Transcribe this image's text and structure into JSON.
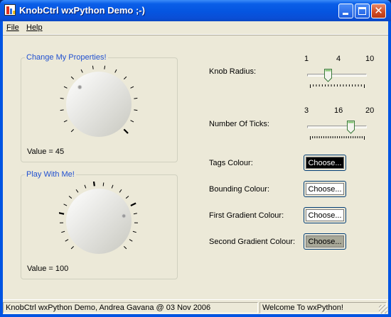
{
  "window": {
    "title": "KnobCtrl wxPython Demo ;-)"
  },
  "menubar": {
    "file": "File",
    "help": "Help"
  },
  "knob1": {
    "group_title": "Change My Properties!",
    "value_text": "Value = 45"
  },
  "knob2": {
    "group_title": "Play With Me!",
    "value_text": "Value = 100"
  },
  "controls": {
    "knob_radius": {
      "label": "Knob Radius:",
      "tick_labels": [
        "1",
        "4",
        "10"
      ],
      "value": 4,
      "min": 1,
      "max": 10
    },
    "number_of_ticks": {
      "label": "Number Of Ticks:",
      "tick_labels": [
        "3",
        "16",
        "20"
      ],
      "value": 16,
      "min": 3,
      "max": 20
    },
    "tags_colour": {
      "label": "Tags Colour:",
      "button": "Choose...",
      "swatch": "#000000",
      "text_color": "#ffffff"
    },
    "bounding_colour": {
      "label": "Bounding Colour:",
      "button": "Choose...",
      "swatch": "#ffffff",
      "text_color": "#000000"
    },
    "first_gradient_colour": {
      "label": "First Gradient Colour:",
      "button": "Choose...",
      "swatch": "#ffffff",
      "text_color": "#000000"
    },
    "second_gradient_colour": {
      "label": "Second Gradient Colour:",
      "button": "Choose...",
      "swatch": "#a8a898",
      "text_color": "#000000"
    }
  },
  "statusbar": {
    "left": "KnobCtrl wxPython Demo, Andrea Gavana @ 03 Nov 2006",
    "right": "Welcome To wxPython!"
  },
  "colors": {
    "group_title": "#2050d0",
    "knob_face_light": "#ffffff",
    "knob_face_dark": "#c8c8c0",
    "tags": "#000000"
  },
  "icons": [
    "app-icon",
    "minimize-icon",
    "maximize-icon",
    "close-icon",
    "size-grip-icon"
  ]
}
